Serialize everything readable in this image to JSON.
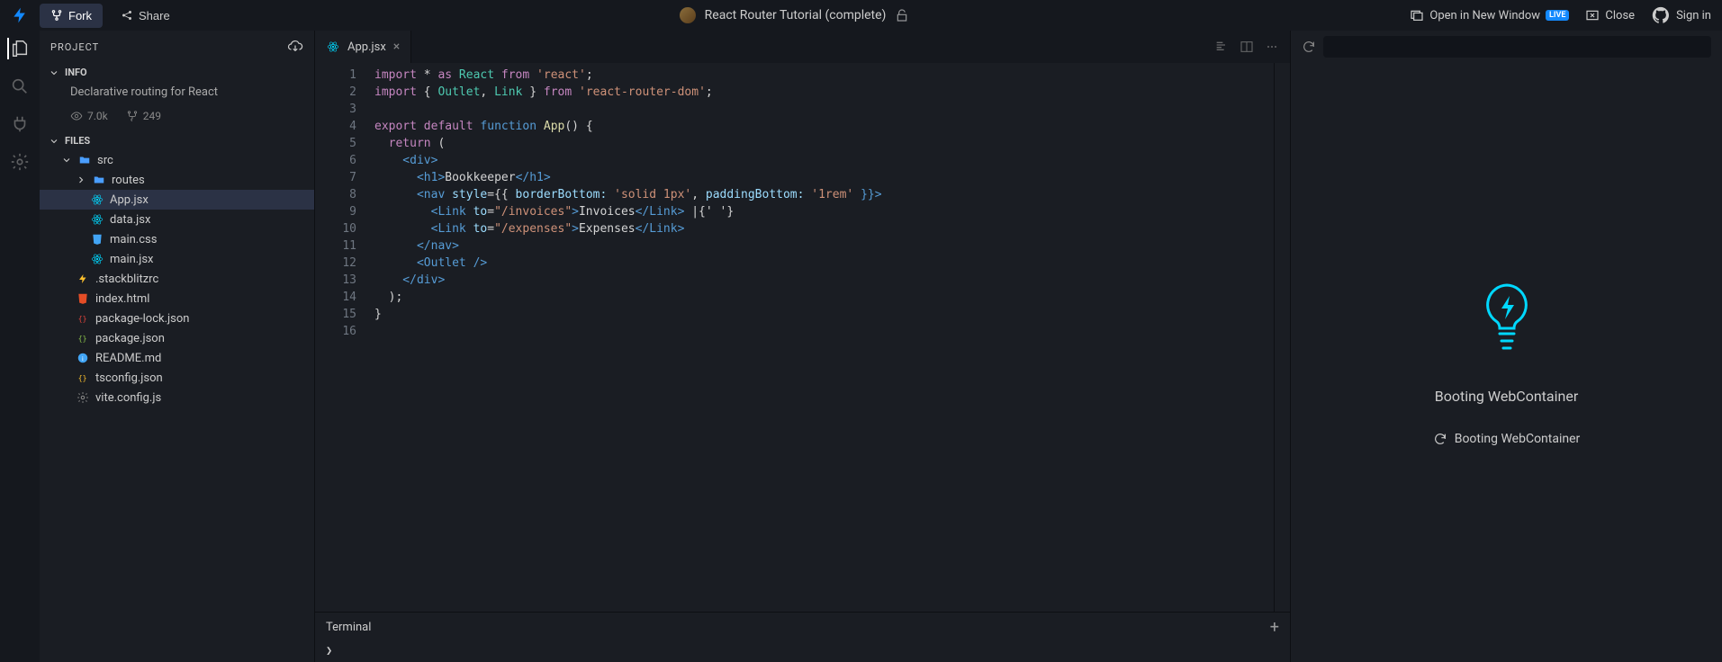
{
  "topbar": {
    "fork_label": "Fork",
    "share_label": "Share",
    "project_title": "React Router Tutorial (complete)",
    "open_new_window_label": "Open in New Window",
    "live_badge": "LIVE",
    "close_label": "Close",
    "signin_label": "Sign in"
  },
  "sidebar": {
    "header": "PROJECT",
    "info_title": "INFO",
    "description": "Declarative routing for React",
    "views": "7.0k",
    "forks": "249",
    "files_title": "FILES",
    "tree": {
      "src": "src",
      "routes": "routes",
      "app_jsx": "App.jsx",
      "data_jsx": "data.jsx",
      "main_css": "main.css",
      "main_jsx": "main.jsx",
      "stackblitzrc": ".stackblitzrc",
      "index_html": "index.html",
      "package_lock": "package-lock.json",
      "package_json": "package.json",
      "readme": "README.md",
      "tsconfig": "tsconfig.json",
      "vite_config": "vite.config.js"
    }
  },
  "editor": {
    "tab_label": "App.jsx",
    "line_numbers": [
      "1",
      "2",
      "3",
      "4",
      "5",
      "6",
      "7",
      "8",
      "9",
      "10",
      "11",
      "12",
      "13",
      "14",
      "15",
      "16"
    ],
    "code_lines": {
      "l1_a": "import",
      "l1_b": " * ",
      "l1_c": "as",
      "l1_d": " React ",
      "l1_e": "from",
      "l1_f": " 'react'",
      "l1_g": ";",
      "l2_a": "import",
      "l2_b": " { ",
      "l2_c": "Outlet",
      "l2_d": ", ",
      "l2_e": "Link",
      "l2_f": " } ",
      "l2_g": "from",
      "l2_h": " 'react-router-dom'",
      "l2_i": ";",
      "l4_a": "export",
      "l4_b": " default ",
      "l4_c": "function",
      "l4_d": " App",
      "l4_e": "() {",
      "l5_a": "  return",
      "l5_b": " (",
      "l6": "    <div>",
      "l7_a": "      <h1>",
      "l7_b": "Bookkeeper",
      "l7_c": "</h1>",
      "l8_a": "      <nav ",
      "l8_b": "style",
      "l8_c": "={{ ",
      "l8_d": "borderBottom:",
      "l8_e": " 'solid 1px'",
      "l8_f": ", ",
      "l8_g": "paddingBottom:",
      "l8_h": " '1rem'",
      "l8_i": " }}>",
      "l9_a": "        <Link ",
      "l9_b": "to",
      "l9_c": "=",
      "l9_d": "\"/invoices\"",
      "l9_e": ">",
      "l9_f": "Invoices",
      "l9_g": "</Link>",
      "l9_h": " |{' '}",
      "l10_a": "        <Link ",
      "l10_b": "to",
      "l10_c": "=",
      "l10_d": "\"/expenses\"",
      "l10_e": ">",
      "l10_f": "Expenses",
      "l10_g": "</Link>",
      "l11": "      </nav>",
      "l12": "      <Outlet />",
      "l13": "    </div>",
      "l14": "  );",
      "l15": "}"
    }
  },
  "terminal": {
    "title": "Terminal",
    "prompt": "❯"
  },
  "preview": {
    "heading": "Booting WebContainer",
    "status": "Booting WebContainer"
  }
}
